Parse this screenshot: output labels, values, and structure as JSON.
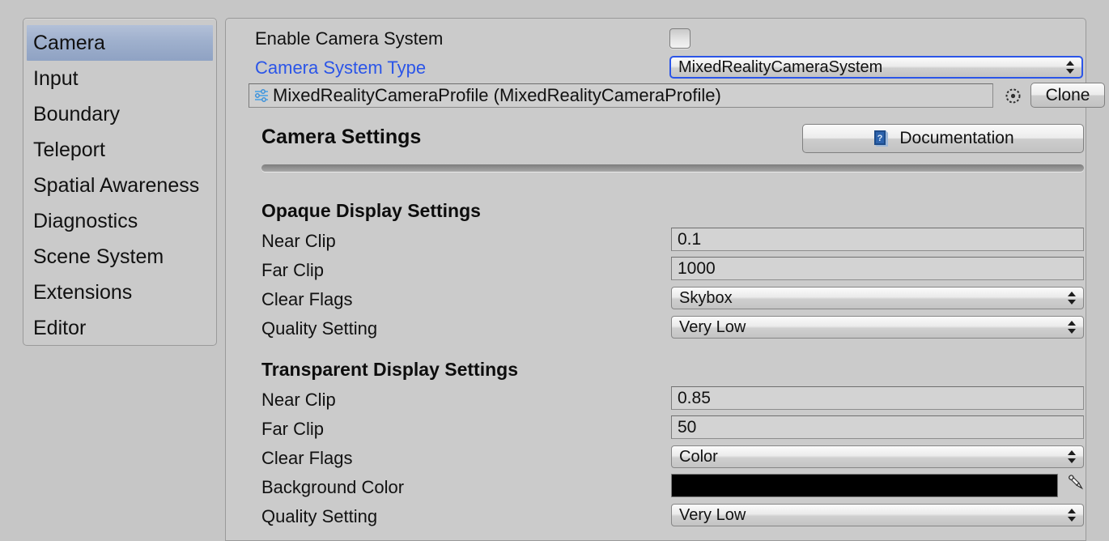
{
  "sidebar": {
    "items": [
      {
        "label": "Camera",
        "selected": true
      },
      {
        "label": "Input",
        "selected": false
      },
      {
        "label": "Boundary",
        "selected": false
      },
      {
        "label": "Teleport",
        "selected": false
      },
      {
        "label": "Spatial Awareness",
        "selected": false
      },
      {
        "label": "Diagnostics",
        "selected": false
      },
      {
        "label": "Scene System",
        "selected": false
      },
      {
        "label": "Extensions",
        "selected": false
      },
      {
        "label": "Editor",
        "selected": false
      }
    ]
  },
  "panel": {
    "enable_camera_system": {
      "label": "Enable Camera System",
      "checked": false,
      "icon": "checkbox-icon"
    },
    "camera_system_type": {
      "label": "Camera System Type",
      "label_color": "#2b55e8",
      "value": "MixedRealityCameraSystem",
      "focused": true,
      "icon": "chevron-updown-icon"
    },
    "profile": {
      "value": "MixedRealityCameraProfile (MixedRealityCameraProfile)",
      "icon": "scriptable-object-sliders-icon",
      "select_icon": "circle-select-icon",
      "clone_label": "Clone"
    },
    "section_title": "Camera Settings",
    "documentation": {
      "label": "Documentation",
      "icon": "help-book-icon"
    },
    "opaque": {
      "title": "Opaque Display Settings",
      "fields": [
        {
          "label": "Near Clip",
          "value": "0.1",
          "type": "text"
        },
        {
          "label": "Far Clip",
          "value": "1000",
          "type": "text"
        },
        {
          "label": "Clear Flags",
          "value": "Skybox",
          "type": "dropdown"
        },
        {
          "label": "Quality Setting",
          "value": "Very Low",
          "type": "dropdown"
        }
      ]
    },
    "transparent": {
      "title": "Transparent Display Settings",
      "fields": [
        {
          "label": "Near Clip",
          "value": "0.85",
          "type": "text"
        },
        {
          "label": "Far Clip",
          "value": "50",
          "type": "text"
        },
        {
          "label": "Clear Flags",
          "value": "Color",
          "type": "dropdown"
        },
        {
          "label": "Background Color",
          "value": "#000000",
          "type": "color",
          "picker_icon": "eyedropper-icon"
        },
        {
          "label": "Quality Setting",
          "value": "Very Low",
          "type": "dropdown"
        }
      ]
    }
  },
  "colors": {
    "accent_blue": "#2b55e8",
    "background": "#c6c6c6",
    "panel": "#cbcbcb",
    "selection": "#9fb0cd"
  }
}
